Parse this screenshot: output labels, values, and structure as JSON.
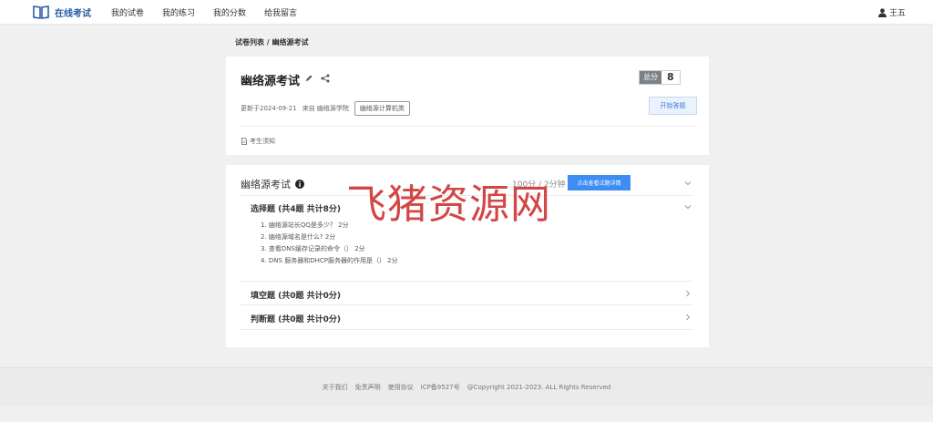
{
  "nav": {
    "brand": "在线考试",
    "items": [
      "我的试卷",
      "我的练习",
      "我的分数",
      "给我留言"
    ],
    "user": "王五"
  },
  "breadcrumb": "试卷列表 / 幽络源考试",
  "exam": {
    "title": "幽络源考试",
    "score_label": "总分",
    "score_value": "8",
    "updated": "更新于2024-09-21",
    "source": "来自 幽络源学院",
    "tag": "幽络源计算机类",
    "start_label": "开始答题",
    "notice": "考生须知"
  },
  "section": {
    "title": "幽络源考试",
    "score_info": "100分 / 2分钟",
    "detail_label": "点击查看试题详情",
    "groups": [
      {
        "title": "选择题 (共4题 共计8分)",
        "questions": [
          "1. 幽络源站长QQ是多少？ 2分",
          "2. 幽络源域名是什么? 2分",
          "3. 查看DNS缓存记录的命令（） 2分",
          "4. DNS 服务器和DHCP服务器的作用是（） 2分"
        ]
      },
      {
        "title": "填空题 (共0题 共计0分)"
      },
      {
        "title": "判断题 (共0题 共计0分)"
      }
    ]
  },
  "watermark": "飞猪资源网",
  "footer": {
    "links": [
      "关于我们",
      "免责声明",
      "使用协议",
      "ICP备9527号",
      "@Copyright 2021-2023. ALL Rights Reserved"
    ]
  },
  "colors": {
    "brand": "#2a5ea8",
    "primary": "#3d8df5",
    "watermark": "#d23c3c"
  }
}
